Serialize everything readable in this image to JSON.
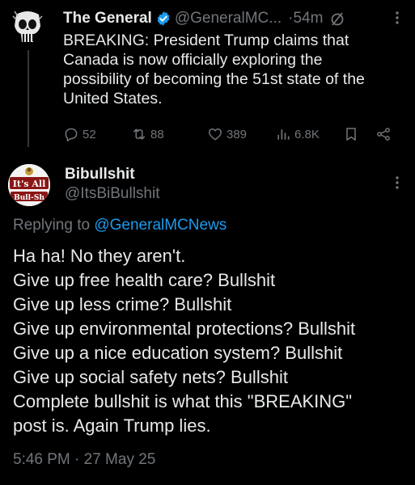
{
  "tweet": {
    "author_name": "The General",
    "handle": "@GeneralMC...",
    "separator": "·",
    "time": "54m",
    "text_lines": [
      "BREAKING: President Trump claims that",
      "Canada is now officially exploring the",
      "possibility of becoming the 51st state of the",
      "United States."
    ],
    "actions": {
      "replies": "52",
      "reposts": "88",
      "likes": "389",
      "views": "6.8K"
    }
  },
  "reply": {
    "author_name": "Bibullshit",
    "handle": "@ItsBiBullshit",
    "avatar_text_top": "It's All",
    "avatar_text_bottom": "Bull-Sh",
    "replying_prefix": "Replying to",
    "replying_to": "@GeneralMCNews",
    "text_lines": [
      "Ha ha! No they aren't.",
      "Give up free health care? Bullshit",
      "Give up less crime? Bullshit",
      "Give up environmental protections? Bullshit",
      "Give up a nice education system? Bullshit",
      "Give up social safety nets? Bullshit",
      "Complete bullshit is what this \"BREAKING\"",
      "post is. Again Trump lies."
    ],
    "timestamp": "5:46 PM · 27 May 25"
  },
  "colors": {
    "background": "#000000",
    "text": "#e7e9ea",
    "muted": "#71767b",
    "link": "#1d9bf0",
    "verified": "#1d9bf0"
  },
  "icons": [
    "punisher-skull-avatar",
    "verified-badge-icon",
    "edited-icon",
    "more-icon",
    "reply-icon",
    "repost-icon",
    "like-icon",
    "views-icon",
    "bookmark-icon",
    "share-icon"
  ]
}
